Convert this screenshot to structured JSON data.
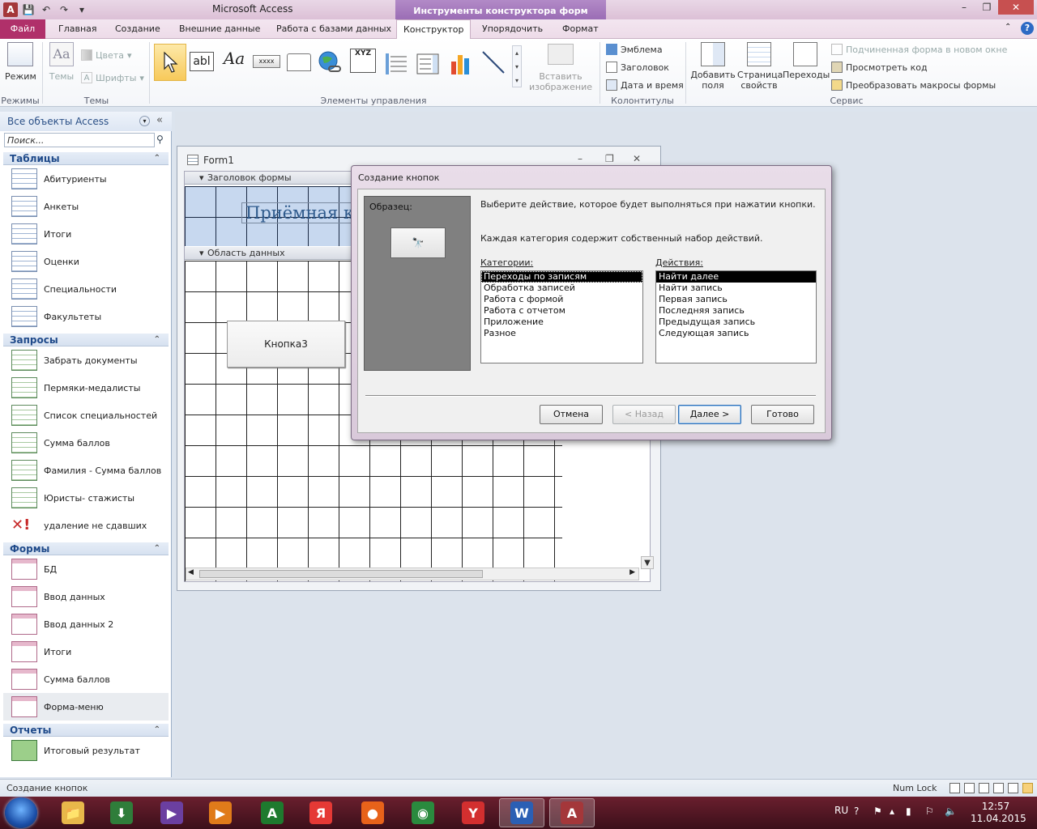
{
  "window": {
    "app_title": "Microsoft Access",
    "context_tab_title": "Инструменты конструктора форм"
  },
  "tabs": [
    {
      "label": "Файл"
    },
    {
      "label": "Главная"
    },
    {
      "label": "Создание"
    },
    {
      "label": "Внешние данные"
    },
    {
      "label": "Работа с базами данных"
    },
    {
      "label": "Конструктор"
    },
    {
      "label": "Упорядочить"
    },
    {
      "label": "Формат"
    }
  ],
  "ribbon": {
    "groups": {
      "modes": "Режимы",
      "themes": "Темы",
      "controls": "Элементы управления",
      "headers": "Колонтитулы",
      "tools": "Сервис"
    },
    "mode_button": "Режим",
    "themes_button": "Темы",
    "colors": "Цвета",
    "fonts": "Шрифты",
    "insert_image": "Вставить изображение",
    "logo": "Эмблема",
    "title": "Заголовок",
    "date_time": "Дата и время",
    "add_fields": "Добавить поля",
    "property_sheet": "Страница свойств",
    "tab_order": "Переходы",
    "subform_new_window": "Подчиненная форма в новом окне",
    "view_code": "Просмотреть код",
    "convert_macros": "Преобразовать макросы формы",
    "text_box_glyph": "abl",
    "label_glyph": "Aa",
    "button_glyph": "xxxx",
    "xyz_glyph": "XYZ"
  },
  "nav": {
    "title": "Все объекты Access",
    "search_placeholder": "Поиск...",
    "sections": [
      {
        "label": "Таблицы",
        "items": [
          "Абитуриенты",
          "Анкеты",
          "Итоги",
          "Оценки",
          "Специальности",
          "Факультеты"
        ]
      },
      {
        "label": "Запросы",
        "items": [
          "Забрать документы",
          "Пермяки-медалисты",
          "Список специальностей",
          "Сумма баллов",
          "Фамилия - Сумма баллов",
          "Юристы- стажисты",
          "удаление не сдавших"
        ]
      },
      {
        "label": "Формы",
        "items": [
          "БД",
          "Ввод данных",
          "Ввод данных 2",
          "Итоги",
          "Сумма баллов",
          "Форма-меню"
        ]
      },
      {
        "label": "Отчеты",
        "items": [
          "Итоговый результат"
        ]
      }
    ]
  },
  "form": {
    "window_title": "Form1",
    "header_band": "Заголовок формы",
    "detail_band": "Область данных",
    "title_text": "Приёмная ко",
    "button_label": "Кнопка3"
  },
  "dialog": {
    "title": "Создание кнопок",
    "sample_label": "Образец:",
    "prompt": "Выберите действие, которое будет выполняться при нажатии кнопки.",
    "info": "Каждая категория содержит собственный набор действий.",
    "categories_label": "Категории:",
    "actions_label": "Действия:",
    "categories": [
      "Переходы по записям",
      "Обработка записей",
      "Работа с формой",
      "Работа с отчетом",
      "Приложение",
      "Разное"
    ],
    "actions": [
      "Найти далее",
      "Найти запись",
      "Первая запись",
      "Последняя запись",
      "Предыдущая запись",
      "Следующая запись"
    ],
    "buttons": {
      "cancel": "Отмена",
      "back": "< Назад",
      "next": "Далее >",
      "finish": "Готово"
    }
  },
  "status": {
    "text": "Создание кнопок",
    "numlock": "Num Lock"
  },
  "taskbar": {
    "lang": "RU",
    "time": "12:57",
    "date": "11.04.2015",
    "apps": [
      "explorer",
      "download",
      "visual-studio",
      "media",
      "excel-a",
      "yandex",
      "firefox",
      "chrome",
      "yandex-browser",
      "word",
      "access"
    ]
  },
  "colors": {
    "accent_file_tab": "#b0306a",
    "context_tab": "#9b6db5",
    "nav_section": "#1f4a8a",
    "taskbar": "#5a1826"
  }
}
